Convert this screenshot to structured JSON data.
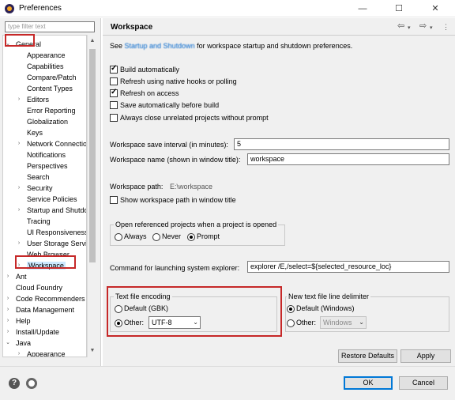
{
  "window": {
    "title": "Preferences",
    "minimize_glyph": "—",
    "maximize_glyph": "☐",
    "close_glyph": "✕"
  },
  "sidebar": {
    "filter_placeholder": "type filter text",
    "items": [
      {
        "label": "General",
        "level": 0,
        "expanded": true
      },
      {
        "label": "Appearance",
        "level": 1,
        "expanded": null
      },
      {
        "label": "Capabilities",
        "level": 1,
        "expanded": null
      },
      {
        "label": "Compare/Patch",
        "level": 1,
        "expanded": null
      },
      {
        "label": "Content Types",
        "level": 1,
        "expanded": null
      },
      {
        "label": "Editors",
        "level": 1,
        "expanded": false
      },
      {
        "label": "Error Reporting",
        "level": 1,
        "expanded": null
      },
      {
        "label": "Globalization",
        "level": 1,
        "expanded": null
      },
      {
        "label": "Keys",
        "level": 1,
        "expanded": null
      },
      {
        "label": "Network Connections",
        "level": 1,
        "expanded": false
      },
      {
        "label": "Notifications",
        "level": 1,
        "expanded": null
      },
      {
        "label": "Perspectives",
        "level": 1,
        "expanded": null
      },
      {
        "label": "Search",
        "level": 1,
        "expanded": null
      },
      {
        "label": "Security",
        "level": 1,
        "expanded": false
      },
      {
        "label": "Service Policies",
        "level": 1,
        "expanded": null
      },
      {
        "label": "Startup and Shutdown",
        "level": 1,
        "expanded": false
      },
      {
        "label": "Tracing",
        "level": 1,
        "expanded": null
      },
      {
        "label": "UI Responsiveness",
        "level": 1,
        "expanded": null
      },
      {
        "label": "User Storage Service",
        "level": 1,
        "expanded": false
      },
      {
        "label": "Web Browser",
        "level": 1,
        "expanded": null
      },
      {
        "label": "Workspace",
        "level": 1,
        "expanded": false,
        "selected": true
      },
      {
        "label": "Ant",
        "level": 0,
        "expanded": false
      },
      {
        "label": "Cloud Foundry",
        "level": 0,
        "expanded": null
      },
      {
        "label": "Code Recommenders",
        "level": 0,
        "expanded": false
      },
      {
        "label": "Data Management",
        "level": 0,
        "expanded": false
      },
      {
        "label": "Help",
        "level": 0,
        "expanded": false
      },
      {
        "label": "Install/Update",
        "level": 0,
        "expanded": false
      },
      {
        "label": "Java",
        "level": 0,
        "expanded": true
      },
      {
        "label": "Appearance",
        "level": 1,
        "expanded": false
      }
    ]
  },
  "main": {
    "title": "Workspace",
    "intro_before": "See ",
    "intro_link": "Startup and Shutdown",
    "intro_after": " for workspace startup and shutdown preferences.",
    "options": [
      {
        "label": "Build automatically",
        "checked": true
      },
      {
        "label": "Refresh using native hooks or polling",
        "checked": false
      },
      {
        "label": "Refresh on access",
        "checked": true
      },
      {
        "label": "Save automatically before build",
        "checked": false
      },
      {
        "label": "Always close unrelated projects without prompt",
        "checked": false
      }
    ],
    "save_interval_label": "Workspace save interval (in minutes):",
    "save_interval_value": "5",
    "ws_name_label": "Workspace name (shown in window title):",
    "ws_name_value": "workspace",
    "ws_path_label": "Workspace path:",
    "ws_path_value": "E:\\workspace",
    "show_path_label": "Show workspace path in window title",
    "open_ref_group": {
      "legend": "Open referenced projects when a project is opened",
      "options": [
        "Always",
        "Never",
        "Prompt"
      ],
      "selected": "Prompt"
    },
    "explorer_label": "Command for launching system explorer:",
    "explorer_value": "explorer /E,/select=${selected_resource_loc}",
    "encoding_group": {
      "legend": "Text file encoding",
      "default_label": "Default (GBK)",
      "other_label": "Other:",
      "other_value": "UTF-8",
      "selected": "Other"
    },
    "delimiter_group": {
      "legend": "New text file line delimiter",
      "default_label": "Default (Windows)",
      "other_label": "Other:",
      "other_value": "Windows",
      "selected": "Default"
    },
    "restore_defaults_label": "Restore Defaults",
    "apply_label": "Apply"
  },
  "footer": {
    "ok_label": "OK",
    "cancel_label": "Cancel",
    "help_glyph": "?"
  },
  "colors": {
    "highlight_red": "#c62828",
    "selection_bg": "#cce8ff",
    "link": "#0066cc"
  }
}
